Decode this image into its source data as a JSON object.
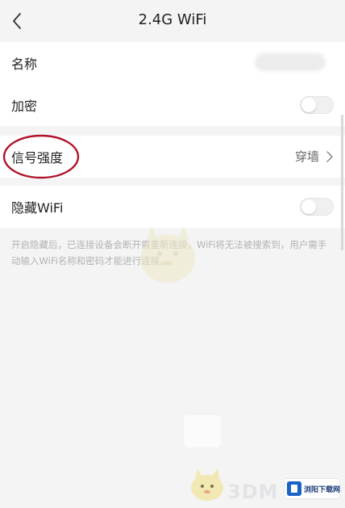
{
  "header": {
    "title": "2.4G WiFi"
  },
  "settings": {
    "name": {
      "label": "名称"
    },
    "encryption": {
      "label": "加密",
      "enabled": false
    },
    "signal_strength": {
      "label": "信号强度",
      "value": "穿墙"
    },
    "hide_wifi": {
      "label": "隐藏WiFi",
      "enabled": false
    }
  },
  "hint": "开启隐藏后，已连接设备会断开需重新连接，WiFi将无法被搜索到，用户需手动输入WiFi名称和密码才能进行连接。",
  "watermark": {
    "logo": "3DM",
    "site_text": "浏阳下载网"
  },
  "colors": {
    "annotation_circle": "#b0132a",
    "background": "#f4f4f5",
    "row": "#ffffff"
  }
}
